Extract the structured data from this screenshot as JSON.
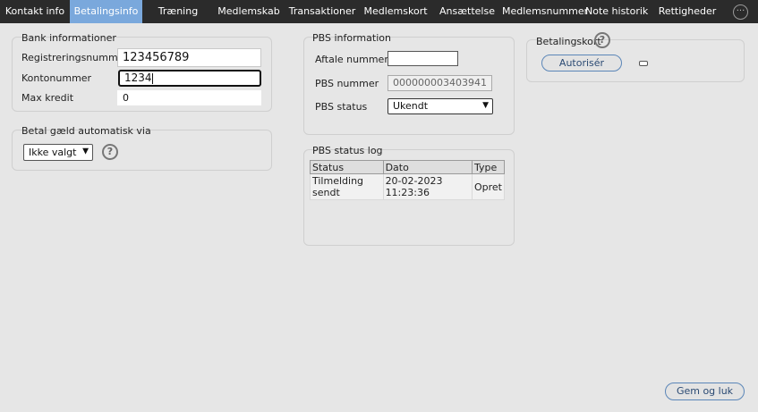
{
  "tabs": [
    {
      "label": "Kontakt info",
      "active": false
    },
    {
      "label": "Betalingsinfo",
      "active": true
    },
    {
      "label": "Træning",
      "active": false
    },
    {
      "label": "Medlemskab",
      "active": false
    },
    {
      "label": "Transaktioner",
      "active": false
    },
    {
      "label": "Medlemskort",
      "active": false
    },
    {
      "label": "Ansættelse",
      "active": false
    },
    {
      "label": "Medlemsnummer",
      "active": false
    },
    {
      "label": "Note historik",
      "active": false
    },
    {
      "label": "Rettigheder",
      "active": false
    }
  ],
  "more_icon": "ellipsis-icon",
  "bank": {
    "title": "Bank informationer",
    "reg_label": "Registreringsnummer",
    "reg_value": "123456789",
    "konto_label": "Kontonummer",
    "konto_value": "1234",
    "max_label": "Max kredit",
    "max_value": "0"
  },
  "auto": {
    "title": "Betal gæld automatisk via",
    "selected": "Ikke valgt"
  },
  "pbs": {
    "title": "PBS information",
    "aftale_label": "Aftale nummer",
    "aftale_value": "",
    "pbsnr_label": "PBS nummer",
    "pbsnr_value": "000000003403941",
    "status_label": "PBS status",
    "status_selected": "Ukendt"
  },
  "pbs_log": {
    "title": "PBS status log",
    "headers": [
      "Status",
      "Dato",
      "Type"
    ],
    "rows": [
      {
        "status_line1": "Tilmelding",
        "status_line2": "sendt",
        "dato_line1": "20-02-2023",
        "dato_line2": "11:23:36",
        "type": "Opret"
      }
    ]
  },
  "betalingskort": {
    "title": "Betalingskort",
    "authorize_label": "Autorisér"
  },
  "save_label": "Gem og luk",
  "colors": {
    "tabbar_bg": "#2b2b2b",
    "active_tab": "#7aa8dc",
    "page_bg": "#e6e6e6",
    "button_border": "#5b86b8"
  }
}
